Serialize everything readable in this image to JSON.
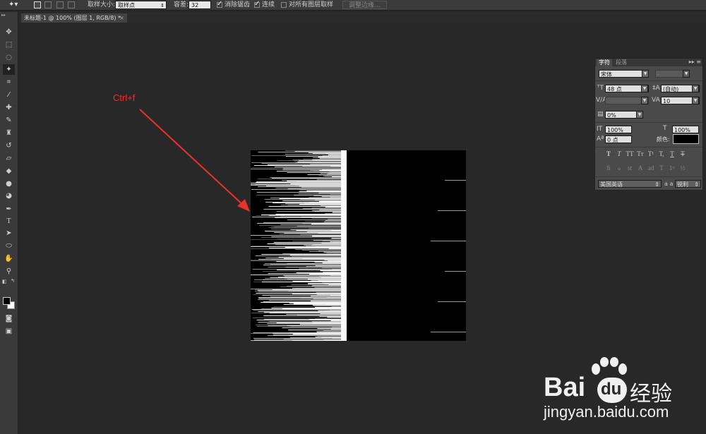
{
  "options_bar": {
    "sample_size_label": "取样大小:",
    "sample_size_value": "取样点",
    "tolerance_label": "容差:",
    "tolerance_value": "32",
    "antialias_label": "消除锯齿",
    "contiguous_label": "连续",
    "sample_all_layers_label": "对所有图层取样",
    "refine_edge_label": "调整边缘..."
  },
  "document": {
    "tab_title": "未标题-1 @ 100% (图层 1, RGB/8) *",
    "close_glyph": "×"
  },
  "annotation": {
    "text": "Ctrl+f",
    "color": "#e8322c"
  },
  "character_panel": {
    "tab_character": "字符",
    "tab_paragraph": "段落",
    "font_family": "宋体",
    "font_style": "-",
    "font_size": "48 点",
    "leading": "(自动)",
    "kerning": "",
    "tracking": "10",
    "tsume": "0%",
    "vertical_scale": "100%",
    "horizontal_scale": "100%",
    "baseline_shift": "0 点",
    "color_label": "颜色:",
    "language": "美国英语",
    "anti_alias": "锐利",
    "aa_label": "a a"
  },
  "watermark": {
    "brand": "Bai",
    "brand_du": "du",
    "brand_cn": "经验",
    "url": "jingyan.baidu.com"
  },
  "colors": {
    "app_bg": "#282828",
    "panel_bg": "#4a4a4a",
    "accent_red": "#e8322c"
  }
}
